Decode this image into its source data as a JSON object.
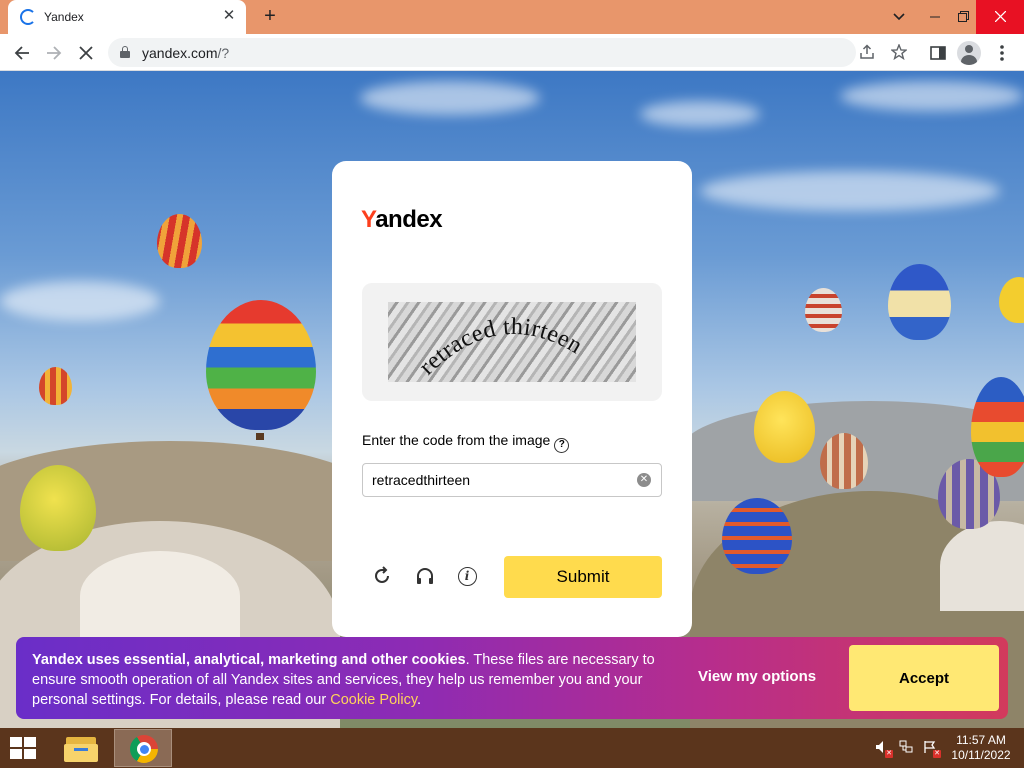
{
  "browser": {
    "tab_title": "Yandex",
    "tab_close": "✕",
    "new_tab": "+",
    "url_host": "yandex.com",
    "url_rest": "/?",
    "icons": [
      "loading-spinner-icon",
      "back-icon",
      "forward-icon",
      "stop-icon",
      "lock-icon",
      "share-icon",
      "star-icon",
      "side-panel-icon",
      "profile-icon",
      "menu-icon"
    ]
  },
  "captcha": {
    "logo_y": "Y",
    "logo_rest": "andex",
    "image_text": "retraced thirteen",
    "prompt": "Enter the code from the image",
    "help": "?",
    "input_value": "retracedthirteen",
    "submit_label": "Submit"
  },
  "cookie_banner": {
    "bold_text": "Yandex uses essential, analytical, marketing and other cookies",
    "body_text": ". These files are necessary to ensure smooth operation of all Yandex sites and services, they help us remember you and your personal settings. For details, please read our ",
    "link_text": "Cookie Policy",
    "end_text": ".",
    "options_label": "View my options",
    "accept_label": "Accept"
  },
  "taskbar": {
    "time": "11:57 AM",
    "date": "10/11/2022"
  },
  "colors": {
    "tabbar": "#e8966b",
    "yandex_red": "#fc3f1d",
    "submit_yellow": "#ffdb4d",
    "accept_yellow": "#ffe873",
    "taskbar": "#5b351c"
  }
}
